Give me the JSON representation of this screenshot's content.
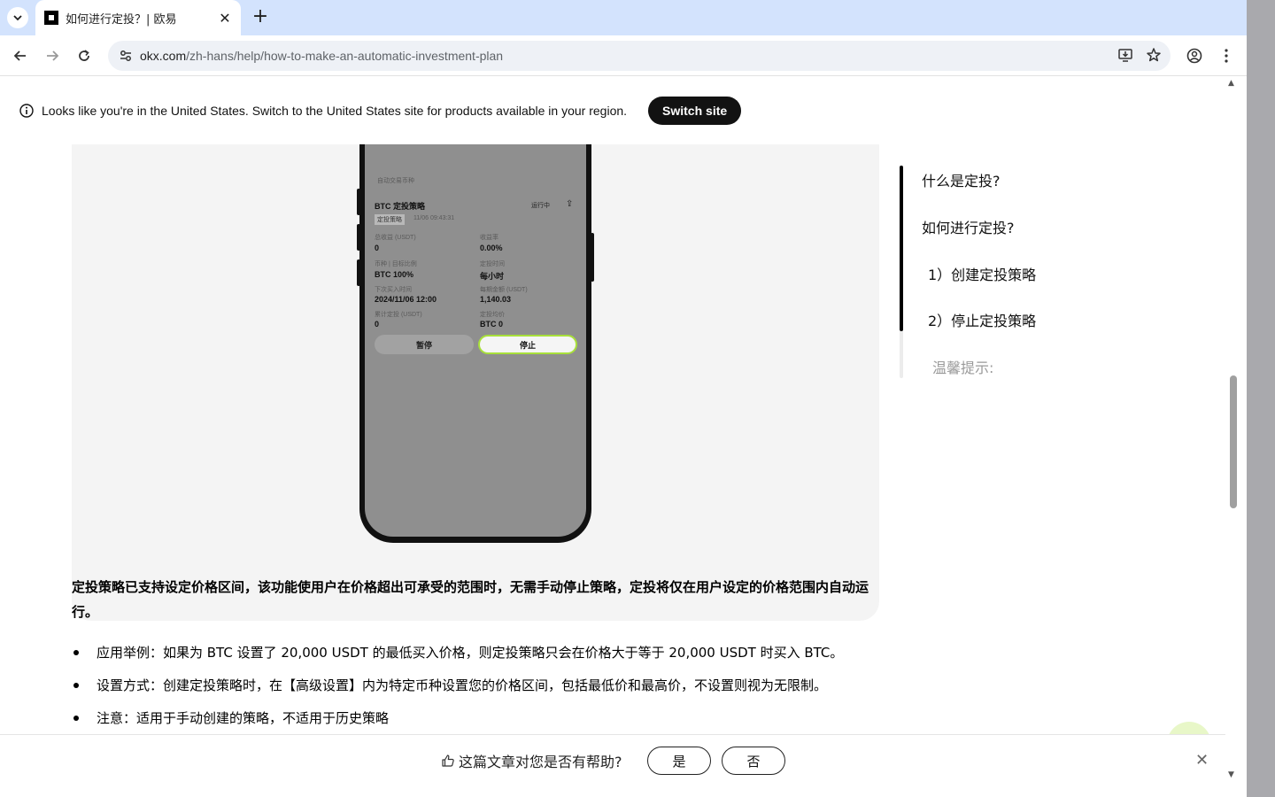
{
  "browser": {
    "tab_title": "如何进行定投？| 欧易",
    "url_host": "okx.com",
    "url_path": "/zh-hans/help/how-to-make-an-automatic-investment-plan"
  },
  "banner": {
    "text": "Looks like you're in the United States. Switch to the United States site for products available in your region.",
    "button": "Switch site"
  },
  "phone_screen": {
    "top_text": "自动交易币种",
    "strategy_title": "BTC 定投策略",
    "status": "运行中",
    "badge": "定投策略",
    "timestamp": "11/06 09:43:31",
    "fields": [
      {
        "label": "总收益 (USDT)",
        "value": "0"
      },
      {
        "label": "收益率",
        "value": "0.00%"
      },
      {
        "label": "币种 | 目标比例",
        "value": "BTC 100%"
      },
      {
        "label": "定投时间",
        "value": "每小时"
      },
      {
        "label": "下次买入时间",
        "value": "2024/11/06 12:00"
      },
      {
        "label": "每期金额 (USDT)",
        "value": "1,140.03"
      },
      {
        "label": "累计定投 (USDT)",
        "value": "0"
      },
      {
        "label": "定投均价",
        "value": "BTC 0"
      }
    ],
    "pause_button": "暂停",
    "stop_button": "停止"
  },
  "article": {
    "bold_paragraph": "定投策略已支持设定价格区间，该功能使用户在价格超出可承受的范围时，无需手动停止策略，定投将仅在用户设定的价格范围内自动运行。",
    "bullets": [
      "应用举例：如果为 BTC 设置了 20,000 USDT 的最低买入价格，则定投策略只会在价格大于等于 20,000 USDT 时买入 BTC。",
      "设置方式：创建定投策略时，在【高级设置】内为特定币种设置您的价格区间，包括最低价和最高价，不设置则视为无限制。",
      "注意：适用于手动创建的策略，不适用于历史策略"
    ]
  },
  "toc": {
    "items": [
      "什么是定投?",
      "如何进行定投?",
      "1）创建定投策略",
      "2）停止定投策略",
      "温馨提示:"
    ]
  },
  "feedback": {
    "question": "这篇文章对您是否有帮助?",
    "yes": "是",
    "no": "否"
  }
}
